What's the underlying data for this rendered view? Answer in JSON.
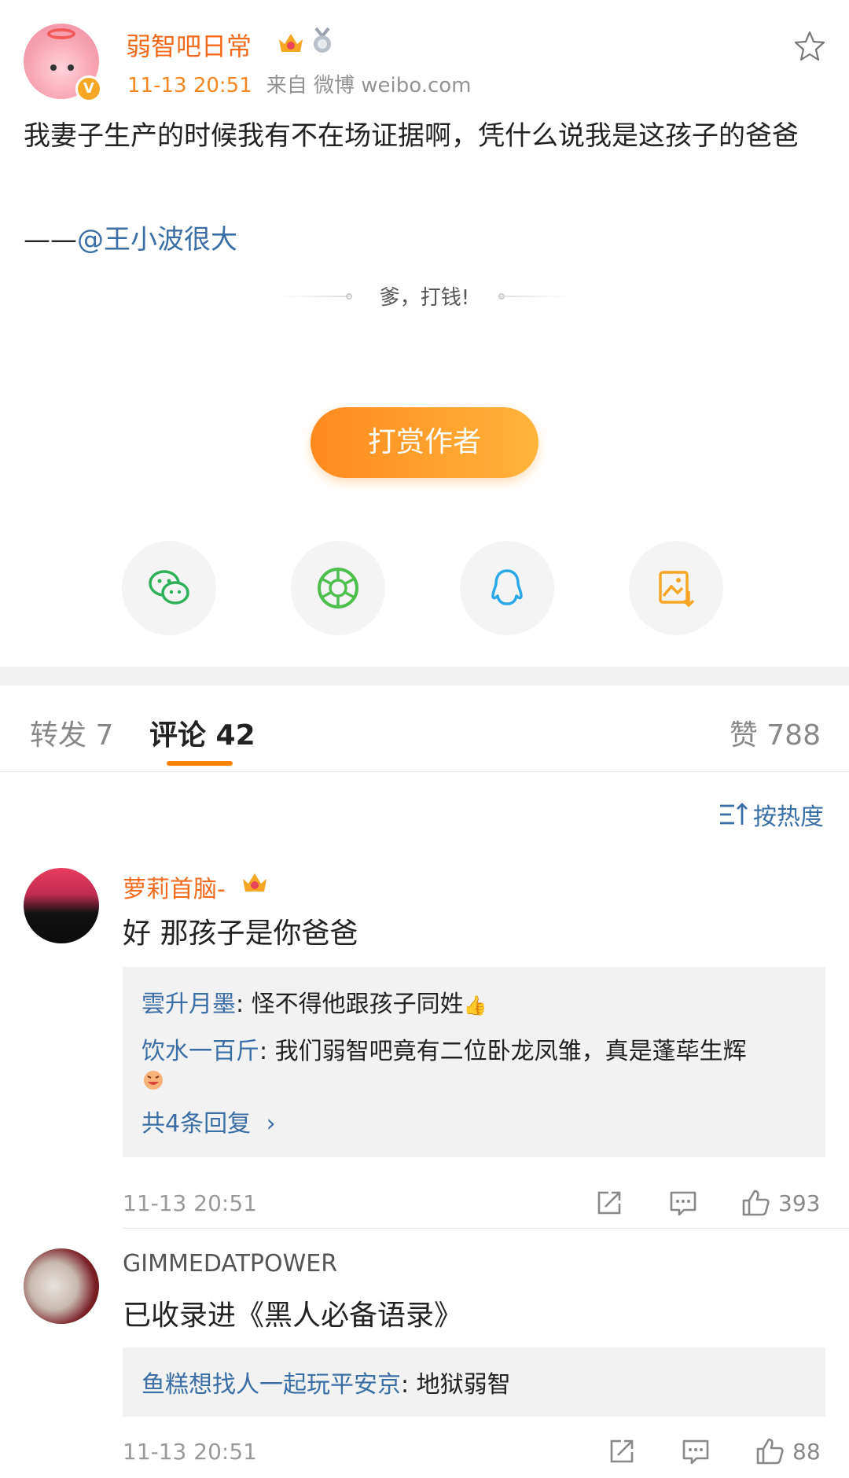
{
  "post": {
    "author": "弱智吧日常",
    "time": "11-13 20:51",
    "source": "来自 微博 weibo.com",
    "body": "我妻子生产的时候我有不在场证据啊，凭什么说我是这孩子的爸爸",
    "credit_prefix": "——",
    "credit_mention": "@王小波很大"
  },
  "reward": {
    "slogan": "爹，打钱!",
    "button_label": "打赏作者"
  },
  "share": [
    "wechat-icon",
    "moments-icon",
    "qq-icon",
    "save-image-icon"
  ],
  "tabs": {
    "repost": "转发 7",
    "comments": "评论 42",
    "likes": "赞 788"
  },
  "sort": {
    "label": "按热度"
  },
  "comments": [
    {
      "user": "萝莉首脑-",
      "text": "好 那孩子是你爸爸",
      "replies": [
        {
          "user": "雲升月墨",
          "text": ": 怪不得他跟孩子同姓"
        },
        {
          "user": "饮水一百斤",
          "text": ": 我们弱智吧竟有二位卧龙凤雏，真是蓬荜生辉"
        }
      ],
      "more_replies": "共4条回复",
      "time": "11-13 20:51",
      "likes": "393"
    },
    {
      "user": "GIMMEDATPOWER",
      "text": "已收录进《黑人必备语录》",
      "replies": [
        {
          "user": "鱼糕想找人一起玩平安京",
          "text": ": 地狱弱智"
        }
      ],
      "time": "11-13 20:51",
      "likes": "88"
    }
  ],
  "colors": {
    "brand_orange": "#ff8200",
    "link_blue": "#3a6ea5",
    "vip_name": "#f26b1d"
  }
}
